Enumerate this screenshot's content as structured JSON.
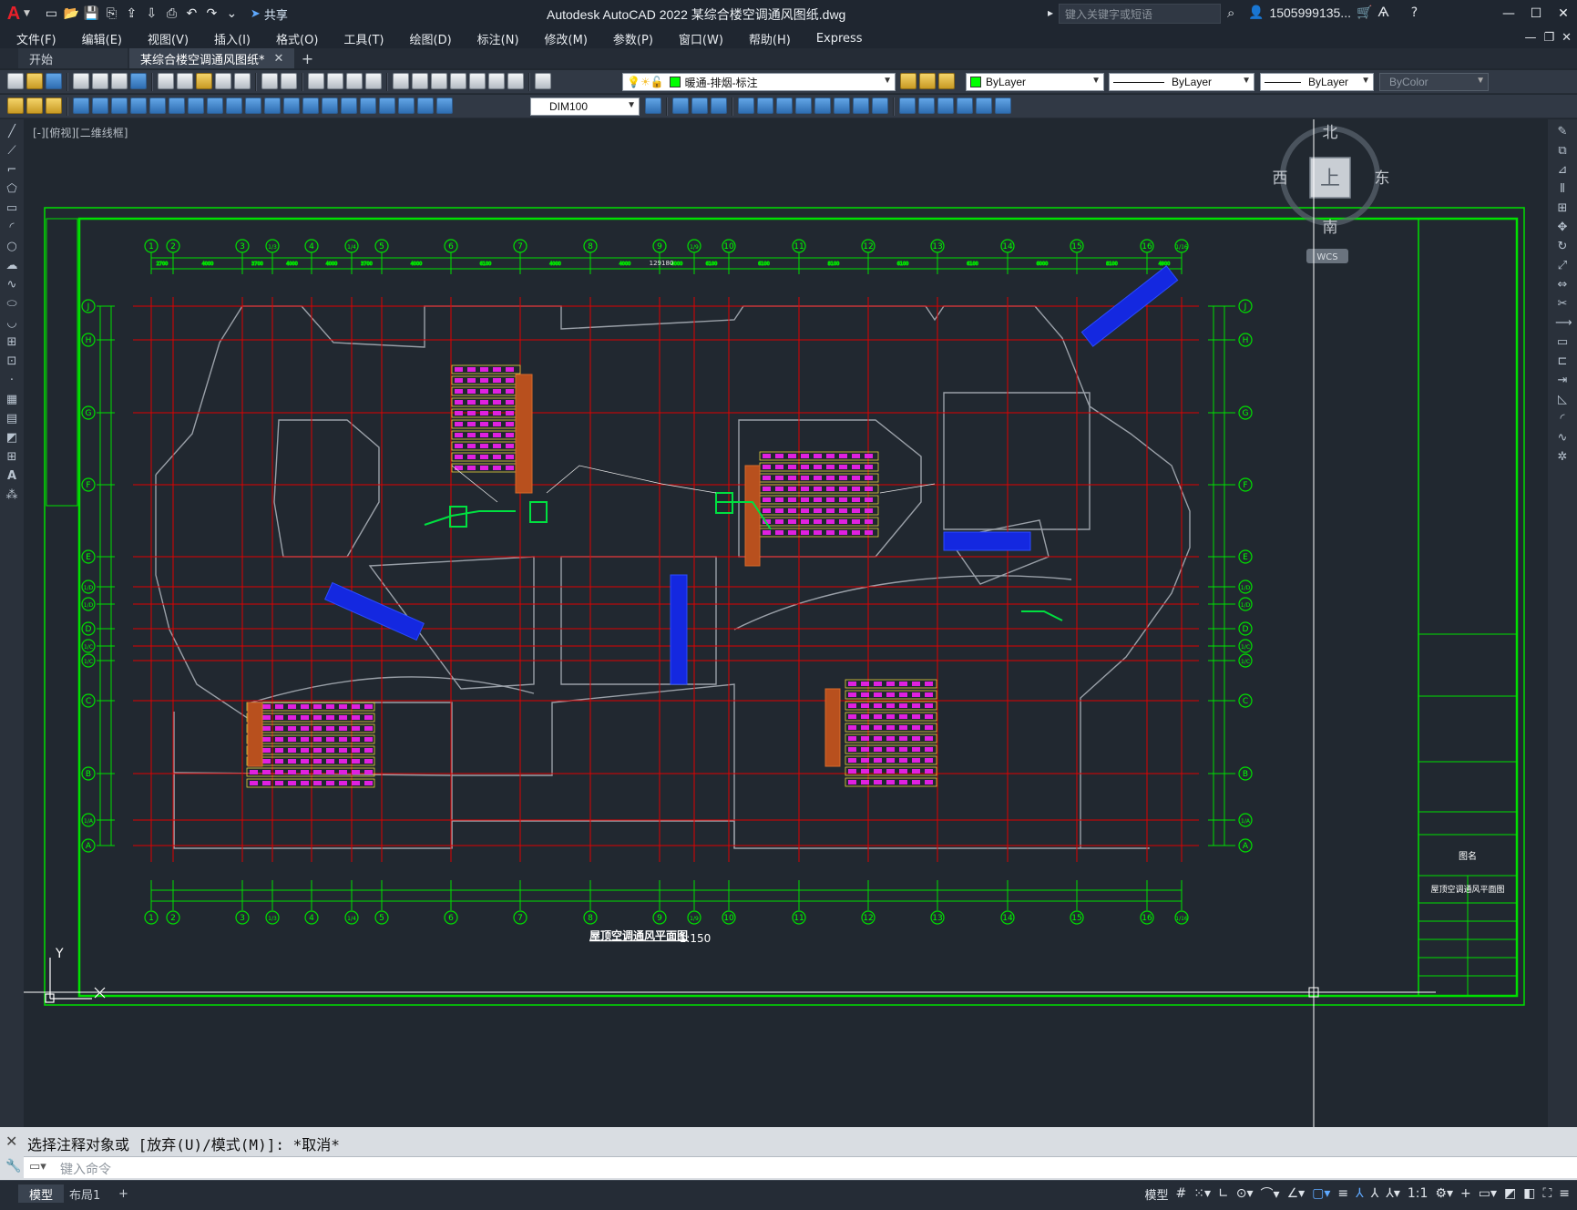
{
  "app": {
    "logo": "A",
    "window_title": "Autodesk AutoCAD 2022    某综合楼空调通风图纸.dwg",
    "search_placeholder": "键入关键字或短语",
    "user_id": "1505999135...",
    "share_label": "共享"
  },
  "menu": [
    "文件(F)",
    "编辑(E)",
    "视图(V)",
    "插入(I)",
    "格式(O)",
    "工具(T)",
    "绘图(D)",
    "标注(N)",
    "修改(M)",
    "参数(P)",
    "窗口(W)",
    "帮助(H)",
    "Express"
  ],
  "tabs": {
    "start": "开始",
    "document": "某综合楼空调通风图纸*",
    "add": "+"
  },
  "toolbar": {
    "layer_name": "暖通-排烟-标注",
    "color": "ByLayer",
    "linetype": "ByLayer",
    "lineweight": "ByLayer",
    "plotstyle": "ByColor",
    "dimstyle": "DIM100",
    "layer_color": "#00ff00"
  },
  "viewport": {
    "label": "[-][俯视][二维线框]",
    "viewcube_top": "上",
    "compass_n": "北",
    "compass_s": "南",
    "compass_e": "东",
    "compass_w": "西",
    "wcs": "WCS"
  },
  "drawing": {
    "title": "屋顶空调通风平面图",
    "scale": "1:150",
    "grid_cols": [
      "1",
      "2",
      "3",
      "1/3",
      "4",
      "1/4",
      "5",
      "6",
      "7",
      "8",
      "9",
      "1/9",
      "10",
      "11",
      "12",
      "13",
      "14",
      "15",
      "16",
      "1/16"
    ],
    "grid_rows": [
      "J",
      "H",
      "G",
      "F",
      "E",
      "1/D",
      "1/D",
      "D",
      "1/C",
      "1/C",
      "C",
      "B",
      "1/A",
      "A"
    ],
    "overall_dim": "129180",
    "top_dims": [
      "2700",
      "4000",
      "3700",
      "4000",
      "4000",
      "3700",
      "4000",
      "6100",
      "4000",
      "4000",
      "4000",
      "6100",
      "6100",
      "8100",
      "6100",
      "6100",
      "6000",
      "8100",
      "4900"
    ],
    "sheet_title": "屋顶空调通风平面图",
    "sheet_label": "图名",
    "ucs_y": "Y",
    "ucs_x": "X"
  },
  "command": {
    "history": "选择注释对象或 [放弃(U)/模式(M)]: *取消*",
    "placeholder": "键入命令"
  },
  "status": {
    "model_tab": "模型",
    "layout_tab": "布局1",
    "add_tab": "+",
    "model_label": "模型",
    "scale": "1:1"
  }
}
